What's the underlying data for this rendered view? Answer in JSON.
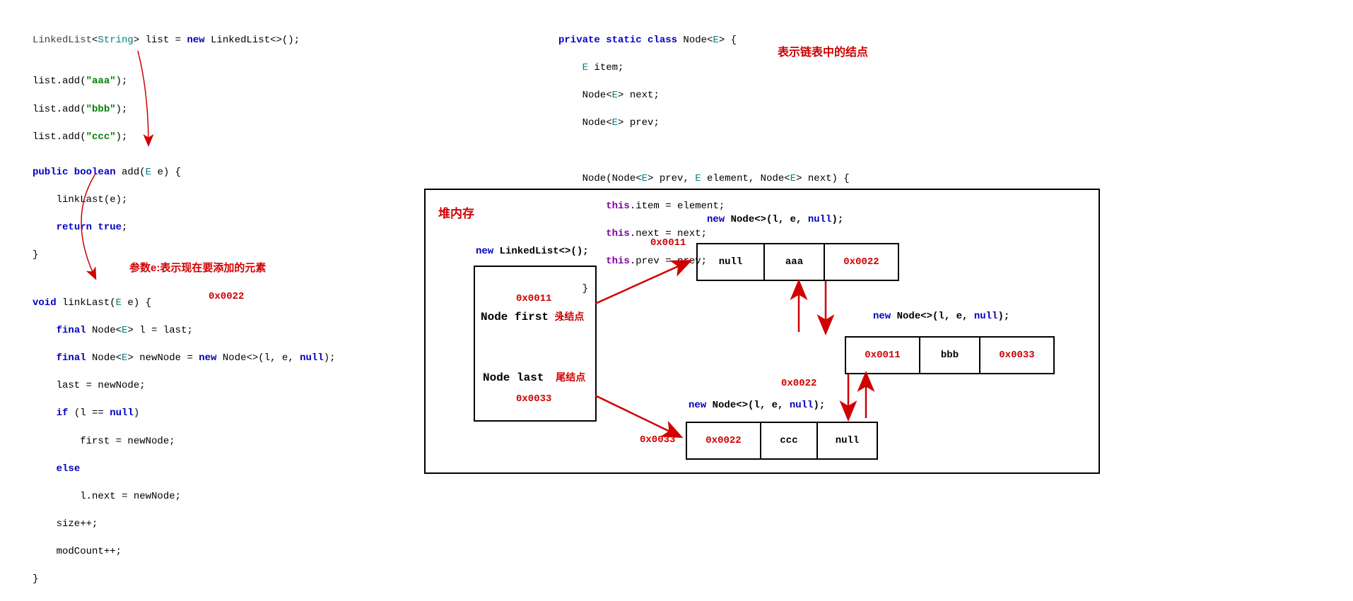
{
  "code1": {
    "l1a": "LinkedList",
    "l1b": "String",
    "l1c": " list = ",
    "l1d": "new",
    "l1e": " LinkedList<>();",
    "l2a": "list.add(",
    "l2b": "\"aaa\"",
    "l2c": ");",
    "l3a": "list.add(",
    "l3b": "\"bbb\"",
    "l3c": ");",
    "l4a": "list.add(",
    "l4b": "\"ccc\"",
    "l4c": ");"
  },
  "code2": {
    "l1a": "public boolean",
    "l1b": " add(",
    "l1c": "E",
    "l1d": " e) {",
    "l2": "    linkLast(e);",
    "l3a": "    ",
    "l3b": "return true",
    "l3c": ";",
    "l4": "}"
  },
  "annot1": "参数e:表示现在要添加的元素",
  "addr_hint": "0x0022",
  "code3": {
    "l1a": "void",
    "l1b": " linkLast(",
    "l1c": "E",
    "l1d": " e) {",
    "l2a": "    ",
    "l2b": "final",
    "l2c": " Node<",
    "l2d": "E",
    "l2e": "> l = last;",
    "l3a": "    ",
    "l3b": "final",
    "l3c": " Node<",
    "l3d": "E",
    "l3e": "> newNode = ",
    "l3f": "new",
    "l3g": " Node<>(l, e, ",
    "l3h": "null",
    "l3i": ");",
    "l4": "    last = newNode;",
    "l5a": "    ",
    "l5b": "if",
    "l5c": " (l == ",
    "l5d": "null",
    "l5e": ")",
    "l6": "        first = newNode;",
    "l7a": "    ",
    "l7b": "else",
    "l8": "        l.next = newNode;",
    "l9": "    size++;",
    "l10": "    modCount++;",
    "l11": "}"
  },
  "code4": {
    "l1a": "private static class",
    "l1b": " Node<",
    "l1c": "E",
    "l1d": "> {",
    "l2a": "    ",
    "l2b": "E",
    "l2c": " item;",
    "l3a": "    Node<",
    "l3b": "E",
    "l3c": "> next;",
    "l4a": "    Node<",
    "l4b": "E",
    "l4c": "> prev;",
    "l5": "",
    "l6a": "    Node(Node<",
    "l6b": "E",
    "l6c": "> prev, ",
    "l6d": "E",
    "l6e": " element, Node<",
    "l6f": "E",
    "l6g": "> next) {",
    "l7a": "        ",
    "l7b": "this",
    "l7c": ".item = element;",
    "l8a": "        ",
    "l8b": "this",
    "l8c": ".next = next;",
    "l9a": "        ",
    "l9b": "this",
    "l9c": ".prev = prev;",
    "l10": "    }",
    "l11": "}"
  },
  "annot2": "表示链表中的结点",
  "heap": {
    "title": "堆内存",
    "ll_new": "new",
    "ll_rest": " LinkedList<>();",
    "first_addr": "0x0011",
    "first_lbl": "Node first",
    "first_note": "头结点",
    "last_lbl": "Node last",
    "last_note": "尾结点",
    "last_addr": "0x0033",
    "node_new": "new",
    "node_rest": " Node<>(l, e, ",
    "node_null": "null",
    "node_end": ");",
    "n1": {
      "addr": "0x0011",
      "prev": "null",
      "item": "aaa",
      "next": "0x0022"
    },
    "n2": {
      "addr": "0x0022",
      "prev": "0x0011",
      "item": "bbb",
      "next": "0x0033"
    },
    "n3": {
      "addr": "0x0033",
      "prev": "0x0022",
      "item": "ccc",
      "next": "null"
    }
  }
}
